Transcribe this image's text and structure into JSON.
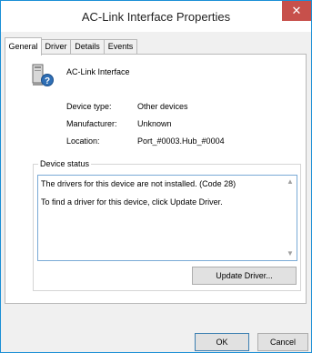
{
  "window": {
    "title": "AC-Link Interface Properties",
    "close_glyph": "✕"
  },
  "tabs": [
    {
      "label": "General",
      "active": true
    },
    {
      "label": "Driver",
      "active": false
    },
    {
      "label": "Details",
      "active": false
    },
    {
      "label": "Events",
      "active": false
    }
  ],
  "device": {
    "name": "AC-Link Interface",
    "icon": "unknown-device-icon",
    "properties": [
      {
        "label": "Device type:",
        "value": "Other devices"
      },
      {
        "label": "Manufacturer:",
        "value": "Unknown"
      },
      {
        "label": "Location:",
        "value": "Port_#0003.Hub_#0004"
      }
    ]
  },
  "status": {
    "legend": "Device status",
    "lines": [
      "The drivers for this device are not installed. (Code 28)",
      "To find a driver for this device, click Update Driver."
    ]
  },
  "buttons": {
    "update_driver": "Update Driver...",
    "ok": "OK",
    "cancel": "Cancel"
  },
  "colors": {
    "window_border": "#1b8fd6",
    "close_button": "#c7504b",
    "status_box_border": "#7aaad6"
  }
}
